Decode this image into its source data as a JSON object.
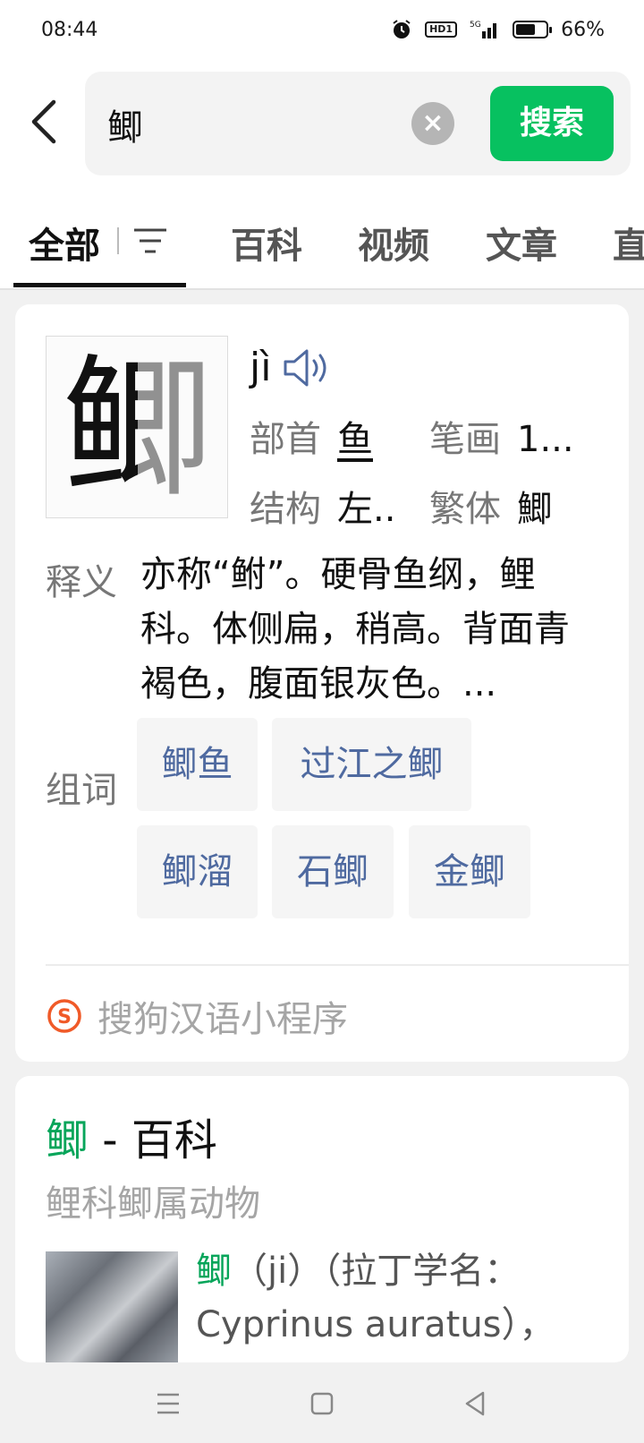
{
  "status_bar": {
    "time": "08:44",
    "network": "5G",
    "hd_label": "HD1",
    "battery_percent": "66%",
    "battery_level": 0.66
  },
  "search": {
    "query": "鲫",
    "search_button": "搜索"
  },
  "tabs": [
    {
      "label": "全部",
      "active": true
    },
    {
      "label": "百科",
      "active": false
    },
    {
      "label": "视频",
      "active": false
    },
    {
      "label": "文章",
      "active": false
    },
    {
      "label": "直",
      "active": false
    }
  ],
  "dict_card": {
    "character": "鲫",
    "pinyin": "jì",
    "radical_label": "部首",
    "radical_value": "鱼",
    "strokes_label": "笔画",
    "strokes_value": "1...",
    "structure_label": "结构",
    "structure_value": "左..",
    "traditional_label": "繁体",
    "traditional_value": "鯽",
    "definition_label": "释义",
    "definition_text": "亦称“鲋”。硬骨鱼纲，鲤科。体侧扁，稍高。背面青褐色，腹面银灰色。...",
    "words_label": "组词",
    "words": [
      "鲫鱼",
      "过江之鲫",
      "鲫溜",
      "石鲫",
      "金鲫"
    ],
    "source": "搜狗汉语小程序"
  },
  "baike_card": {
    "title_char": "鲫",
    "title_suffix": " - 百科",
    "subtitle": "鲤科鲫属动物",
    "snippet_char": "鲫",
    "snippet_text": "（ji）（拉丁学名：Cyprinus auratus），"
  },
  "colors": {
    "accent_green": "#07c160",
    "link_blue": "#4f6aa0",
    "muted_gray": "#a5a5a5"
  }
}
